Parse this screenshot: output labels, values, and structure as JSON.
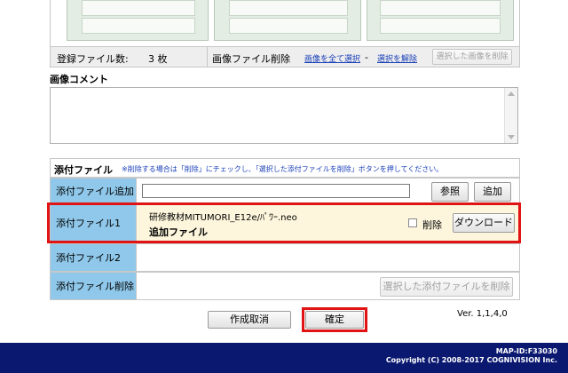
{
  "images": {
    "count_label": "登録ファイル数:",
    "count_value": "3 枚",
    "delete_label": "画像ファイル削除",
    "select_all_link": "画像を全て選択",
    "separator": "-",
    "deselect_link": "選択を解除",
    "delete_selected_button": "選択した画像を削除"
  },
  "comment": {
    "title": "画像コメント",
    "value": ""
  },
  "attachments": {
    "title": "添付ファイル",
    "note": "※削除する場合は「削除」にチェックし、「選択した添付ファイルを削除」ボタンを押してください。",
    "add_row_label": "添付ファイル追加",
    "add_input_value": "",
    "browse_button": "参照",
    "add_button": "追加",
    "file1": {
      "label": "添付ファイル1",
      "filename": "研修教材MITUMORI_E12e/ﾊﾟﾜｰ.neo",
      "status": "追加ファイル",
      "delete_label": "削除",
      "delete_checked": false,
      "download_button": "ダウンロード"
    },
    "file2": {
      "label": "添付ファイル2"
    },
    "delete_row_label": "添付ファイル削除",
    "delete_selected_button": "選択した添付ファイルを削除"
  },
  "actions": {
    "cancel_button": "作成取消",
    "confirm_button": "確定",
    "version": "Ver. 1,1,4,0"
  },
  "footer": {
    "map_id": "MAP-ID:F33030",
    "copyright": "Copyright (C) 2008-2017 COGNIVISION Inc."
  },
  "colors": {
    "label_cell": "#8fc8ea",
    "highlight_row": "#fdf6dc",
    "highlight_border": "#e01414",
    "footer_bar": "#0a1870",
    "link": "#1a3fb8"
  }
}
